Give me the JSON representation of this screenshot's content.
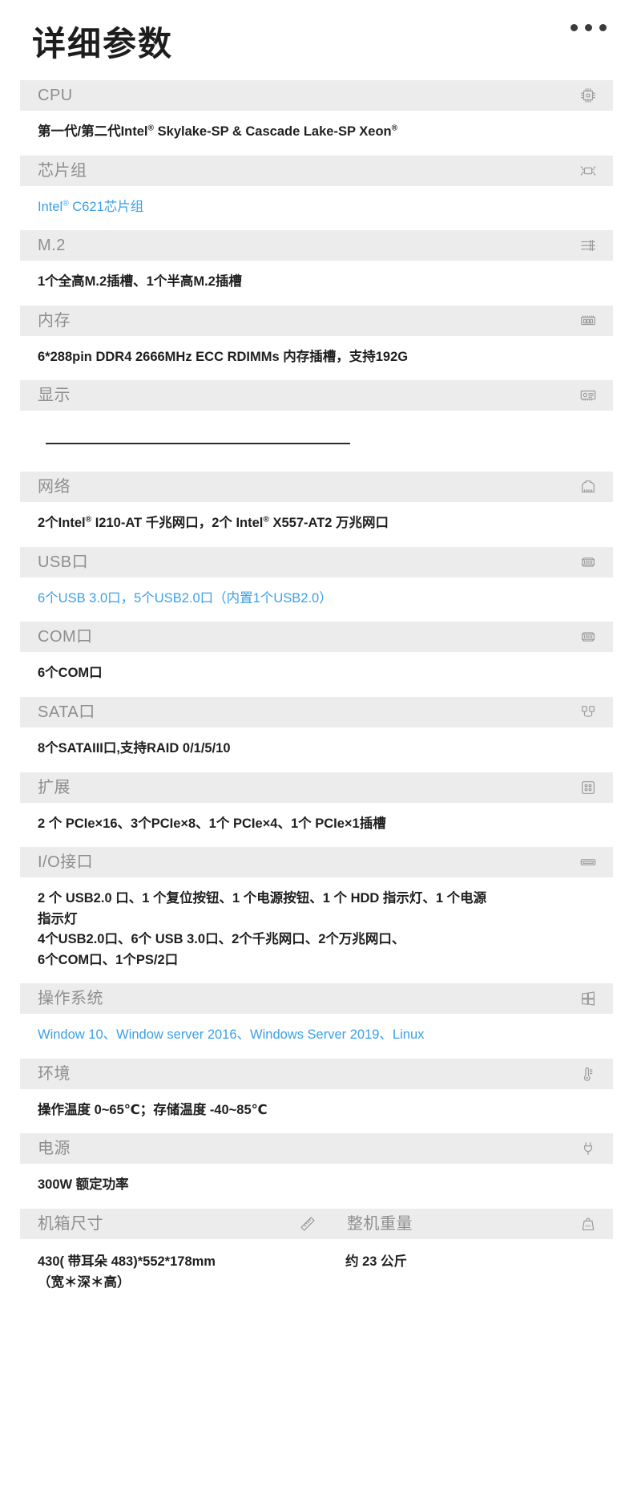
{
  "header": {
    "title": "详细参数",
    "more_menu": "•••"
  },
  "specs": [
    {
      "label": "CPU",
      "icon": "cpu-chip-icon",
      "value_color": "dark",
      "lines": [
        "第一代/第二代Intel® Skylake-SP & Cascade Lake-SP Xeon®"
      ]
    },
    {
      "label": "芯片组",
      "icon": "chipset-icon",
      "value_color": "blue",
      "lines": [
        "Intel® C621芯片组"
      ]
    },
    {
      "label": "M.2",
      "icon": "m2-slot-icon",
      "value_color": "dark",
      "lines": [
        "1个全高M.2插槽、1个半高M.2插槽"
      ]
    },
    {
      "label": "内存",
      "icon": "memory-module-icon",
      "value_color": "dark",
      "lines": [
        "6*288pin DDR4 2666MHz ECC RDIMMs 内存插槽，支持192G"
      ]
    },
    {
      "label": "显示",
      "icon": "graphics-card-icon",
      "value_color": "dark",
      "ruled": true,
      "lines": [
        ""
      ]
    },
    {
      "label": "网络",
      "icon": "rj45-network-icon",
      "value_color": "dark",
      "lines": [
        "2个Intel® I210-AT 千兆网口，2个 Intel® X557-AT2 万兆网口"
      ]
    },
    {
      "label": "USB口",
      "icon": "usb-port-icon",
      "value_color": "blue",
      "lines": [
        "6个USB 3.0口，5个USB2.0口（内置1个USB2.0）"
      ]
    },
    {
      "label": "COM口",
      "icon": "com-port-icon",
      "value_color": "dark",
      "lines": [
        "6个COM口"
      ]
    },
    {
      "label": "SATA口",
      "icon": "sata-cable-icon",
      "value_color": "dark",
      "lines": [
        "8个SATAIII口,支持RAID 0/1/5/10"
      ]
    },
    {
      "label": "扩展",
      "icon": "expansion-slot-icon",
      "value_color": "dark",
      "lines": [
        "2 个 PCIe×16、3个PCIe×8、1个 PCIe×4、1个 PCIe×1插槽"
      ]
    },
    {
      "label": "I/O接口",
      "icon": "io-port-icon",
      "value_color": "dark",
      "lines": [
        "2 个 USB2.0 口、1 个复位按钮、1 个电源按钮、1 个 HDD 指示灯、1 个电源",
        "指示灯",
        "4个USB2.0口、6个 USB 3.0口、2个千兆网口、2个万兆网口、",
        "6个COM口、1个PS/2口"
      ]
    },
    {
      "label": "操作系统",
      "icon": "windows-icon",
      "value_color": "blue",
      "lines": [
        "Window 10、Window server 2016、Windows Server 2019、Linux"
      ]
    },
    {
      "label": "环境",
      "icon": "thermometer-icon",
      "value_color": "dark",
      "lines": [
        "操作温度 0~65℃；存储温度 -40~85℃"
      ]
    },
    {
      "label": "电源",
      "icon": "power-plug-icon",
      "value_color": "dark",
      "lines": [
        "300W 额定功率"
      ]
    }
  ],
  "dual_row": {
    "left": {
      "label": "机箱尺寸",
      "icon": "ruler-icon",
      "lines": [
        "430( 带耳朵  483)*552*178mm",
        "（宽＊深＊高）"
      ]
    },
    "right": {
      "label": "整机重量",
      "icon": "weight-scale-icon",
      "lines": [
        "约 23 公斤"
      ]
    }
  },
  "colors": {
    "accent_blue": "#3aa0e8",
    "header_bg": "#ececec",
    "header_text": "#8e8e8e",
    "value_text": "#1f1f1f",
    "page_bg": "#ffffff"
  }
}
